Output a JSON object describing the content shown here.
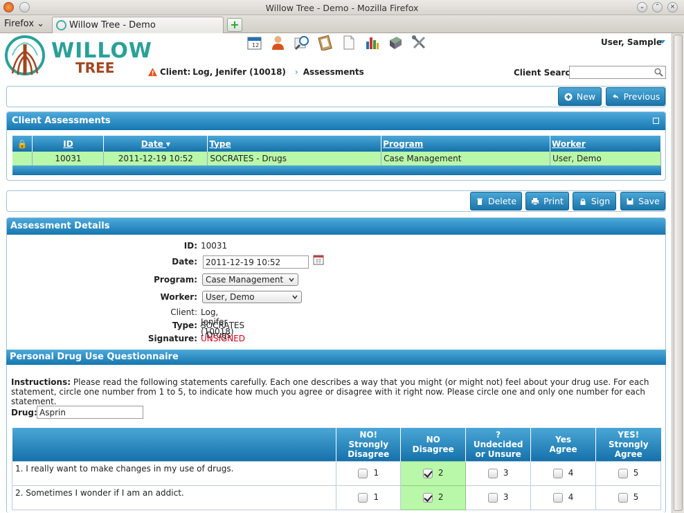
{
  "window": {
    "title": "Willow Tree - Demo - Mozilla Firefox",
    "menu_label": "Firefox",
    "tab_label": "Willow Tree - Demo",
    "new_tab": "+"
  },
  "header": {
    "logo_top": "WILLOW",
    "logo_bottom": "TREE",
    "user": "User, Sample",
    "client_label": "Client:",
    "client_name": "Log, Jenifer (10018)",
    "breadcrumb": "Assessments",
    "client_search_label": "Client Search",
    "client_search_value": ""
  },
  "top_buttons": {
    "new": "New",
    "previous": "Previous"
  },
  "assessments": {
    "title": "Client Assessments",
    "columns": [
      "ID",
      "Date",
      "Type",
      "Program",
      "Worker"
    ],
    "rows": [
      {
        "id": "10031",
        "date": "2011-12-19 10:52",
        "type": "SOCRATES - Drugs",
        "program": "Case Management",
        "worker": "User, Demo"
      }
    ]
  },
  "action_buttons": {
    "delete": "Delete",
    "print": "Print",
    "sign": "Sign",
    "save": "Save"
  },
  "details": {
    "title": "Assessment Details",
    "id_label": "ID:",
    "id_value": "10031",
    "date_label": "Date:",
    "date_value": "2011-12-19 10:52",
    "program_label": "Program:",
    "program_value": "Case Management",
    "worker_label": "Worker:",
    "worker_value": "User, Demo",
    "client_label": "Client:",
    "client_value": "Log, Jenifer (10018)",
    "type_label": "Type:",
    "type_value": "SOCRATES - Drugs",
    "signature_label": "Signature:",
    "signature_value": "UNSIGNED"
  },
  "questionnaire": {
    "title": "Personal Drug Use Questionnaire",
    "instructions_label": "Instructions:",
    "instructions_text": "Please read the following statements carefully. Each one describes a way that you might (or might not) feel about your drug use. For each statement, circle one number from 1 to 5, to indicate how much you agree or disagree with it right now. Please circle one and only one number for each statement.",
    "drug_label": "Drug:",
    "drug_value": "Asprin",
    "scale": [
      {
        "l1": "NO!",
        "l2": "Strongly",
        "l3": "Disagree",
        "num": "1"
      },
      {
        "l1": "NO",
        "l2": "Disagree",
        "l3": "",
        "num": "2"
      },
      {
        "l1": "?",
        "l2": "Undecided",
        "l3": "or Unsure",
        "num": "3"
      },
      {
        "l1": "Yes",
        "l2": "Agree",
        "l3": "",
        "num": "4"
      },
      {
        "l1": "YES!",
        "l2": "Strongly",
        "l3": "Agree",
        "num": "5"
      }
    ],
    "items": [
      {
        "text": "1. I really want to make changes in my use of drugs.",
        "selected": "2"
      },
      {
        "text": "2. Sometimes I wonder if I am an addict.",
        "selected": "2"
      }
    ]
  },
  "colors": {
    "accent": "#1c75ab",
    "selected_row": "#b9f7a9",
    "unsigned": "#d0021b",
    "logo_teal": "#2aa198",
    "logo_brown": "#a2451f"
  }
}
